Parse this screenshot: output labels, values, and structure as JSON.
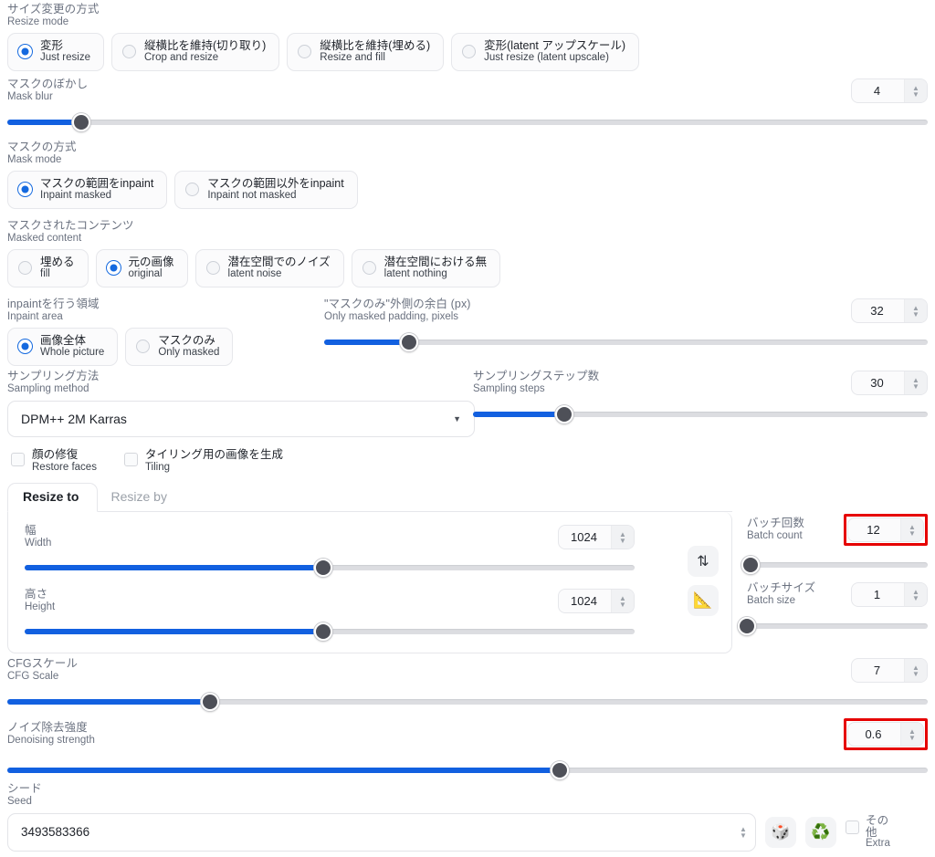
{
  "resize_mode": {
    "label_ja": "サイズ変更の方式",
    "label_en": "Resize mode",
    "options": [
      {
        "ja": "変形",
        "en": "Just resize",
        "selected": true
      },
      {
        "ja": "縦横比を維持(切り取り)",
        "en": "Crop and resize",
        "selected": false
      },
      {
        "ja": "縦横比を維持(埋める)",
        "en": "Resize and fill",
        "selected": false
      },
      {
        "ja": "変形(latent アップスケール)",
        "en": "Just resize (latent upscale)",
        "selected": false
      }
    ]
  },
  "mask_blur": {
    "label_ja": "マスクのぼかし",
    "label_en": "Mask blur",
    "value": "4",
    "percent": 8
  },
  "mask_mode": {
    "label_ja": "マスクの方式",
    "label_en": "Mask mode",
    "options": [
      {
        "ja": "マスクの範囲をinpaint",
        "en": "Inpaint masked",
        "selected": true
      },
      {
        "ja": "マスクの範囲以外をinpaint",
        "en": "Inpaint not masked",
        "selected": false
      }
    ]
  },
  "masked_content": {
    "label_ja": "マスクされたコンテンツ",
    "label_en": "Masked content",
    "options": [
      {
        "ja": "埋める",
        "en": "fill",
        "selected": false
      },
      {
        "ja": "元の画像",
        "en": "original",
        "selected": true
      },
      {
        "ja": "潜在空間でのノイズ",
        "en": "latent noise",
        "selected": false
      },
      {
        "ja": "潜在空間における無",
        "en": "latent nothing",
        "selected": false
      }
    ]
  },
  "inpaint_area": {
    "label_ja": "inpaintを行う領域",
    "label_en": "Inpaint area",
    "options": [
      {
        "ja": "画像全体",
        "en": "Whole picture",
        "selected": true
      },
      {
        "ja": "マスクのみ",
        "en": "Only masked",
        "selected": false
      }
    ]
  },
  "only_masked_padding": {
    "label_ja": "\"マスクのみ\"外側の余白 (px)",
    "label_en": "Only masked padding, pixels",
    "value": "32",
    "percent": 14
  },
  "sampling_method": {
    "label_ja": "サンプリング方法",
    "label_en": "Sampling method",
    "value": "DPM++ 2M Karras",
    "caret": "chevron-down-icon"
  },
  "sampling_steps": {
    "label_ja": "サンプリングステップ数",
    "label_en": "Sampling steps",
    "value": "30",
    "percent": 20
  },
  "restore_faces": {
    "label_ja": "顔の修復",
    "label_en": "Restore faces",
    "checked": false
  },
  "tiling": {
    "label_ja": "タイリング用の画像を生成",
    "label_en": "Tiling",
    "checked": false
  },
  "resize_tabs": {
    "tabs": [
      {
        "label": "Resize to",
        "active": true
      },
      {
        "label": "Resize by",
        "active": false
      }
    ]
  },
  "width": {
    "label_ja": "幅",
    "label_en": "Width",
    "value": "1024",
    "percent": 49
  },
  "height": {
    "label_ja": "高さ",
    "label_en": "Height",
    "value": "1024",
    "percent": 49
  },
  "swap_button": {
    "icon": "swap-vertical-icon",
    "glyph": "⇅"
  },
  "ratio_button": {
    "icon": "triangle-ruler-icon",
    "glyph": "📐"
  },
  "batch_count": {
    "label_ja": "バッチ回数",
    "label_en": "Batch count",
    "value": "12",
    "percent": 2,
    "highlighted": true
  },
  "batch_size": {
    "label_ja": "バッチサイズ",
    "label_en": "Batch size",
    "value": "1",
    "percent": 0,
    "highlighted": false
  },
  "cfg_scale": {
    "label_ja": "CFGスケール",
    "label_en": "CFG Scale",
    "value": "7",
    "percent": 22
  },
  "denoising_strength": {
    "label_ja": "ノイズ除去強度",
    "label_en": "Denoising strength",
    "value": "0.6",
    "percent": 60,
    "highlighted": true
  },
  "seed": {
    "label_ja": "シード",
    "label_en": "Seed",
    "value": "3493583366",
    "dice_button": {
      "icon": "dice-icon",
      "glyph": "🎲"
    },
    "recycle_button": {
      "icon": "recycle-icon",
      "glyph": "♻️"
    },
    "extra": {
      "label_ja_line1": "その",
      "label_ja_line2": "他",
      "label_en": "Extra",
      "checked": false
    }
  },
  "colors": {
    "accent": "#1260e0",
    "radio_on": "#1469df",
    "highlight": "#e60000",
    "track": "#dcdde1",
    "thumb": "#4e5058",
    "label_text": "#6b7280"
  }
}
